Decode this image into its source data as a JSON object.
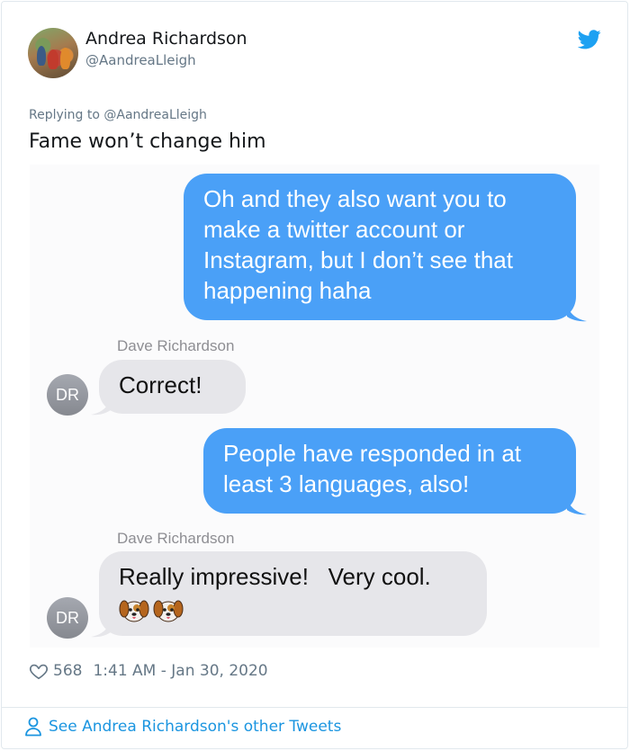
{
  "author": {
    "display_name": "Andrea Richardson",
    "handle": "@AandreaLleigh"
  },
  "reply": {
    "prefix": "Replying to",
    "handle": "@AandreaLleigh"
  },
  "tweet_text": "Fame won’t change him",
  "conversation": {
    "messages": [
      {
        "direction": "outgoing",
        "lines": [
          "Oh and they also want you to",
          "make a twitter account or",
          "Instagram, but I don’t see that",
          "happening haha"
        ]
      },
      {
        "direction": "incoming",
        "sender": "Dave Richardson",
        "initials": "DR",
        "text": "Correct!"
      },
      {
        "direction": "outgoing",
        "lines": [
          "People have responded in at",
          "least 3 languages, also!"
        ]
      },
      {
        "direction": "incoming",
        "sender": "Dave Richardson",
        "initials": "DR",
        "text": "Really impressive!   Very cool.",
        "emoji": [
          "dog-face",
          "dog-face"
        ]
      }
    ]
  },
  "meta": {
    "likes": "568",
    "timestamp": "1:41 AM - Jan 30, 2020"
  },
  "footer": {
    "more_tweets_label": "See Andrea Richardson's other Tweets"
  },
  "colors": {
    "twitter_blue": "#1da1f2",
    "link_blue": "#1b95e0",
    "imessage_blue": "#4aa0f7",
    "incoming_gray": "#e6e6ea"
  },
  "icons": [
    "twitter-bird-icon",
    "heart-icon",
    "person-icon",
    "dog-face-emoji"
  ]
}
